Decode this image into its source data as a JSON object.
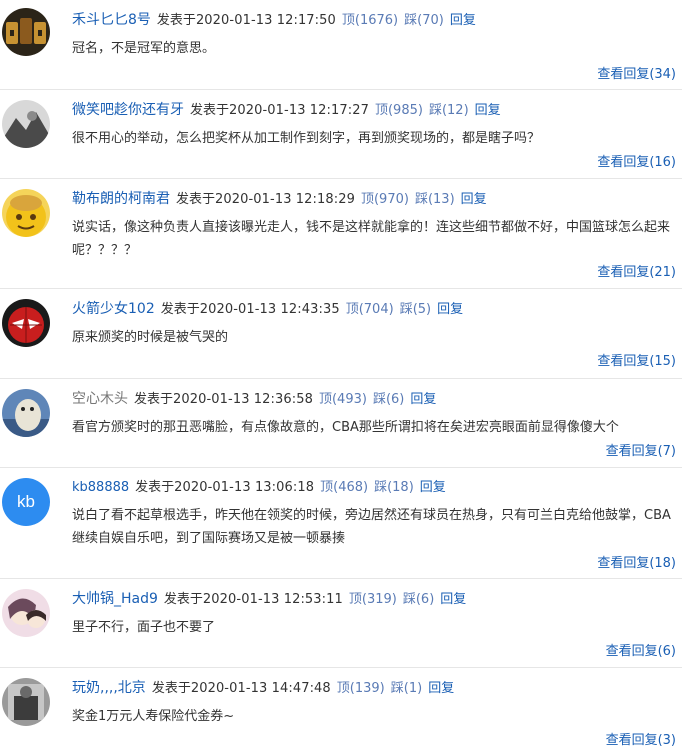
{
  "comments": [
    {
      "user": "禾斗匕匕8号",
      "posted": "发表于",
      "time": "2020-01-13 12:17:50",
      "up": "顶(1676)",
      "down": "踩(70)",
      "reply": "回复",
      "text": "冠名，不是冠军的意思。",
      "view": "查看回复(34)",
      "avatar_colors": [
        "#2b2418",
        "#c79232"
      ]
    },
    {
      "user": "微笑吧趁你还有牙",
      "posted": "发表于",
      "time": "2020-01-13 12:17:27",
      "up": "顶(985)",
      "down": "踩(12)",
      "reply": "回复",
      "text": "很不用心的举动，怎么把奖杯从加工制作到刻字，再到颁奖现场的，都是瞎子吗？",
      "view": "查看回复(16)",
      "avatar_colors": [
        "#d8d8d8",
        "#4a4a4a"
      ]
    },
    {
      "user": "勒布朗的柯南君",
      "posted": "发表于",
      "time": "2020-01-13 12:18:29",
      "up": "顶(970)",
      "down": "踩(13)",
      "reply": "回复",
      "text": "说实话，像这种负责人直接该曝光走人，钱不是这样就能拿的！连这些细节都做不好，中国篮球怎么起来呢？？？？",
      "view": "查看回复(21)",
      "avatar_colors": [
        "#f2c21a",
        "#d9a53c"
      ]
    },
    {
      "user": "火箭少女102",
      "posted": "发表于",
      "time": "2020-01-13 12:43:35",
      "up": "顶(704)",
      "down": "踩(5)",
      "reply": "回复",
      "text": "原来颁奖的时候是被气哭的",
      "view": "查看回复(15)",
      "avatar_colors": [
        "#1a1a1a",
        "#c81e1e"
      ]
    },
    {
      "user": "空心木头",
      "posted": "发表于",
      "time": "2020-01-13 12:36:58",
      "up": "顶(493)",
      "down": "踩(6)",
      "reply": "回复",
      "text": "看官方颁奖时的那丑恶嘴脸，有点像故意的，CBA那些所谓扣将在矣进宏亮眼面前显得像傻大个",
      "view": "查看回复(7)",
      "avatar_colors": [
        "#5f86b8",
        "#e8e4d6"
      ]
    },
    {
      "user": "kb88888",
      "posted": "发表于",
      "time": "2020-01-13 13:06:18",
      "up": "顶(468)",
      "down": "踩(18)",
      "reply": "回复",
      "text": "说白了看不起草根选手，昨天他在领奖的时候，旁边居然还有球员在热身，只有可兰白克给他鼓掌，CBA继续自娱自乐吧，到了国际赛场又是被一顿暴揍",
      "view": "查看回复(18)",
      "avatar_text": "kb",
      "avatar_colors": [
        "#2d8cf0",
        "#ffffff"
      ]
    },
    {
      "user": "大帅锅_Had9",
      "posted": "发表于",
      "time": "2020-01-13 12:53:11",
      "up": "顶(319)",
      "down": "踩(6)",
      "reply": "回复",
      "text": "里子不行，面子也不要了",
      "view": "查看回复(6)",
      "avatar_colors": [
        "#f0dde6",
        "#6b4a5c"
      ]
    },
    {
      "user": "玩奶,,,,北京",
      "posted": "发表于",
      "time": "2020-01-13 14:47:48",
      "up": "顶(139)",
      "down": "踩(1)",
      "reply": "回复",
      "text": "奖金1万元人寿保险代金券~",
      "view": "查看回复(3)",
      "avatar_colors": [
        "#9a9a9a",
        "#3c3c3c"
      ]
    }
  ]
}
